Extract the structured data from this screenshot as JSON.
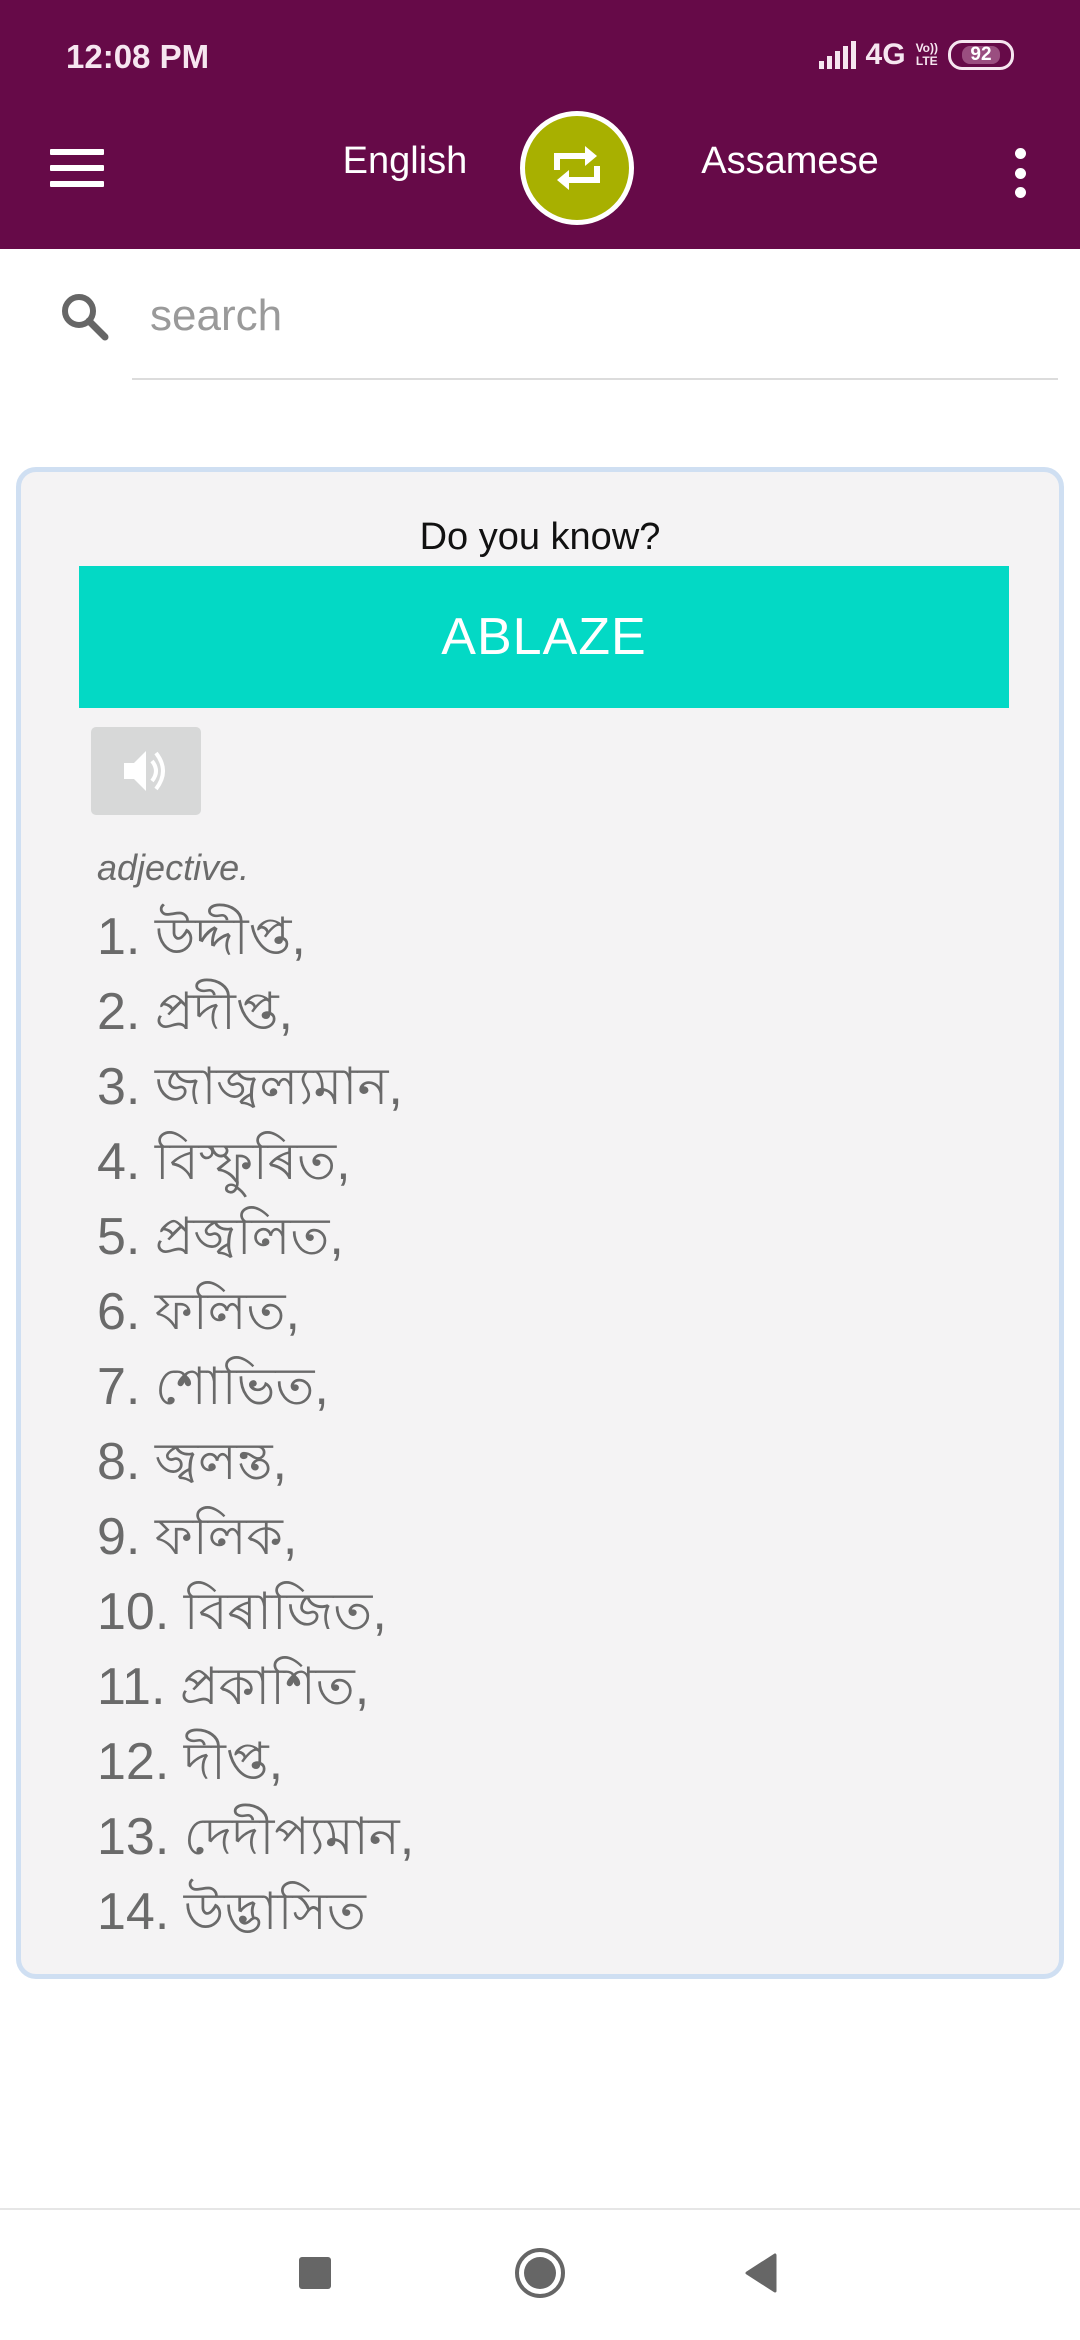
{
  "status_bar": {
    "time": "12:08 PM",
    "network": "4G",
    "volte_top": "Vo))",
    "volte_bottom": "LTE",
    "battery": "92"
  },
  "app_bar": {
    "source_language": "English",
    "target_language": "Assamese",
    "colors": {
      "bar": "#660a48",
      "swap_button": "#a8b000"
    }
  },
  "search": {
    "placeholder": "search",
    "value": ""
  },
  "word_card": {
    "heading": "Do you know?",
    "word": "ABLAZE",
    "part_of_speech": "adjective.",
    "meanings": [
      "1. উদ্দীপ্ত,",
      "2. প্রদীপ্ত,",
      "3. জাজ্বল্যমান,",
      "4. বিস্ফুৰিত,",
      "5. প্রজ্বলিত,",
      "6. ফলিত,",
      "7. শোভিত,",
      "8. জ্বলন্ত,",
      "9. ফলিক,",
      "10. বিৰাজিত,",
      "11. প্রকাশিত,",
      "12. দীপ্ত,",
      "13. দেদীপ্যমান,",
      "14. উদ্ভাসিত"
    ],
    "colors": {
      "banner": "#03d9c5",
      "border": "#cfdff2"
    }
  },
  "icons": {
    "menu": "hamburger-icon",
    "swap": "swap-icon",
    "overflow": "more-vert-icon",
    "search": "search-icon",
    "speaker": "speaker-icon",
    "nav_recents": "square-icon",
    "nav_home": "circle-icon",
    "nav_back": "triangle-back-icon"
  }
}
